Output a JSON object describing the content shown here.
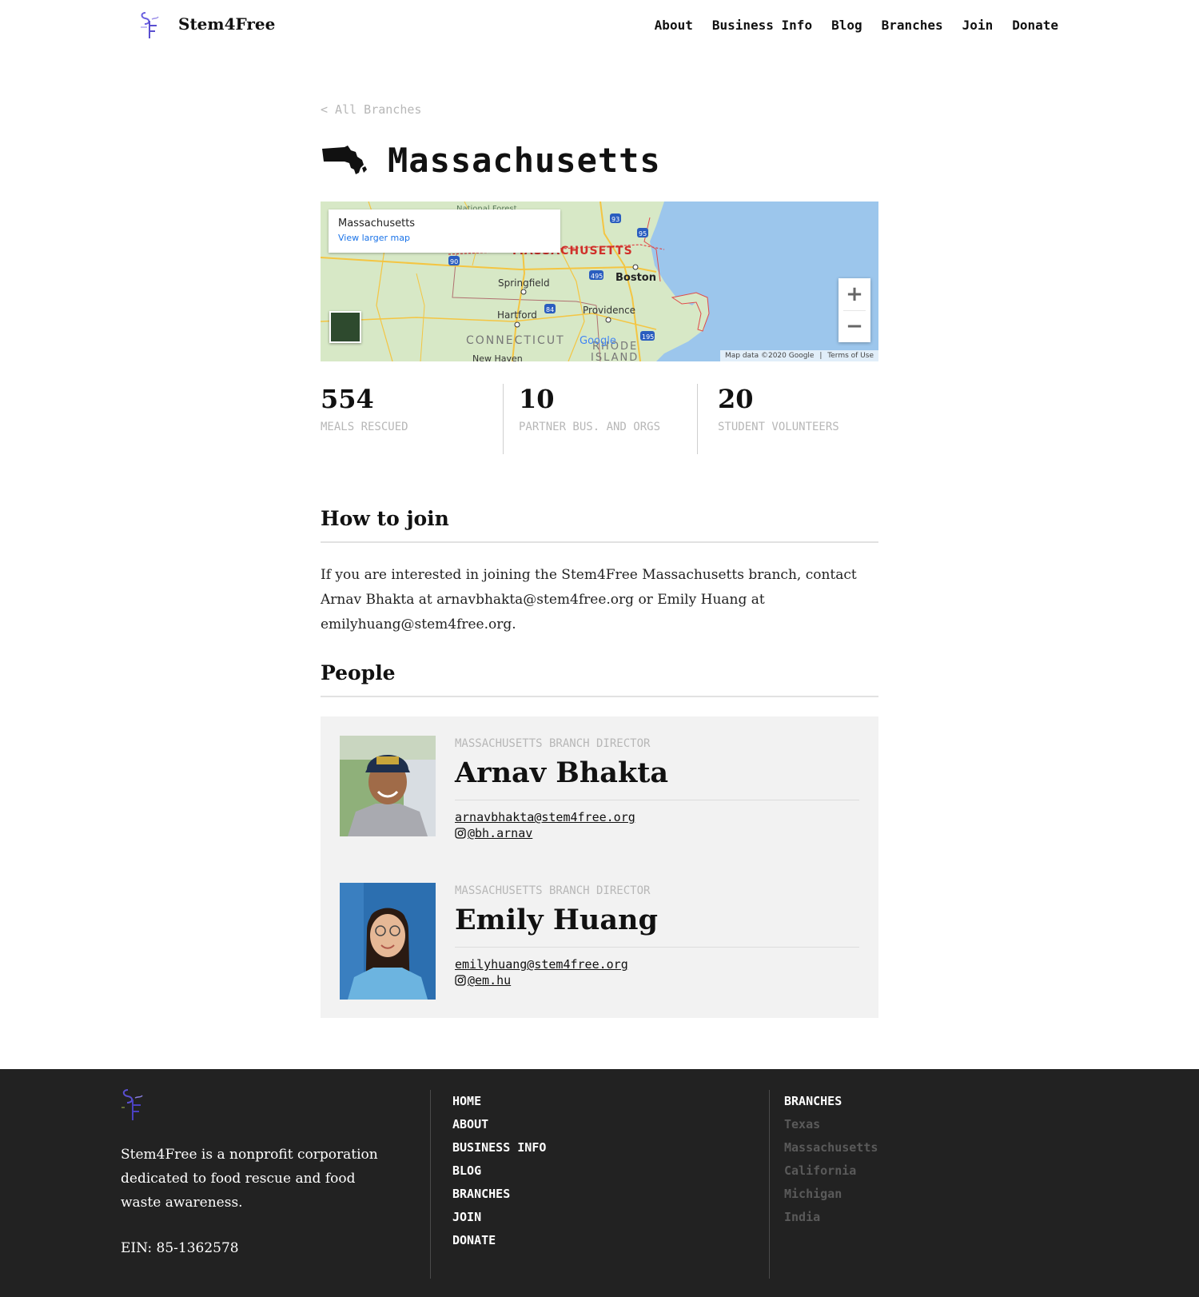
{
  "header": {
    "brand": "Stem4Free",
    "nav": [
      "About",
      "Business Info",
      "Blog",
      "Branches",
      "Join",
      "Donate"
    ]
  },
  "back_link": "< All Branches",
  "page_title": "Massachusetts",
  "map": {
    "card_title": "Massachusetts",
    "card_link": "View larger map",
    "zoom_in": "+",
    "zoom_out": "−",
    "attribution": "Map data ©2020 Google",
    "terms": "Terms of Use",
    "labels": {
      "state": "MASSACHUSETTS",
      "boston": "Boston",
      "springfield": "Springfield",
      "hartford": "Hartford",
      "providence": "Providence",
      "connecticut": "CONNECTICUT",
      "rhode": "RHODE",
      "island": "ISLAND",
      "new_haven": "New Haven",
      "forest": "National Forest",
      "google": "Google",
      "i90": "90",
      "i93": "93",
      "i95": "95",
      "i495": "495",
      "i84": "84",
      "i195": "195"
    },
    "colors": {
      "land": "#d7e8c6",
      "water": "#9cc6ec",
      "road": "#f4c542",
      "border": "#e04a4a"
    }
  },
  "stats": [
    {
      "value": "554",
      "label": "MEALS RESCUED"
    },
    {
      "value": "10",
      "label": "PARTNER BUS. AND ORGS"
    },
    {
      "value": "20",
      "label": "STUDENT VOLUNTEERS"
    }
  ],
  "how_to_join": {
    "heading": "How to join",
    "text": "If you are interested in joining the Stem4Free Massachusetts branch, contact Arnav Bhakta at arnavbhakta@stem4free.org or Emily Huang at emilyhuang@stem4free.org."
  },
  "people": {
    "heading": "People",
    "list": [
      {
        "role": "MASSACHUSETTS BRANCH DIRECTOR",
        "name": "Arnav Bhakta",
        "email": "arnavbhakta@stem4free.org",
        "instagram": "@bh.arnav"
      },
      {
        "role": "MASSACHUSETTS BRANCH DIRECTOR",
        "name": "Emily Huang",
        "email": "emilyhuang@stem4free.org",
        "instagram": "@em.hu"
      }
    ]
  },
  "footer": {
    "description": "Stem4Free is a nonprofit corporation dedicated to food rescue and food waste awareness.",
    "ein": "EIN: 85-1362578",
    "nav": [
      "HOME",
      "ABOUT",
      "BUSINESS INFO",
      "BLOG",
      "BRANCHES",
      "JOIN",
      "DONATE"
    ],
    "branches_heading": "BRANCHES",
    "branches": [
      "Texas",
      "Massachusetts",
      "California",
      "Michigan",
      "India"
    ]
  },
  "colors": {
    "footer_bg": "#222222",
    "muted_text": "#b7b7b7",
    "people_bg": "#f2f2f2",
    "logo_accent": "#5a4fd0"
  }
}
